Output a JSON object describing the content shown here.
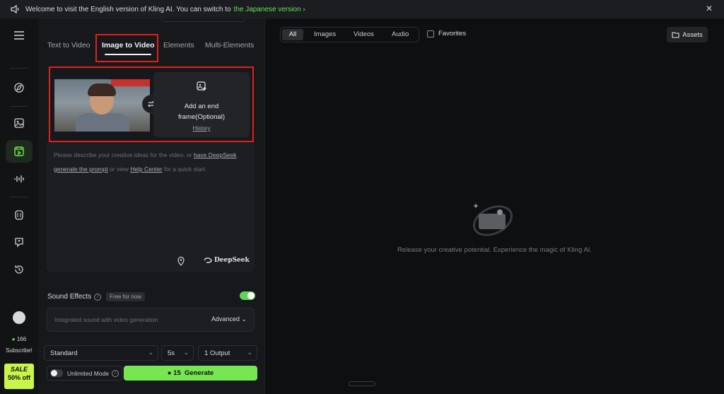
{
  "banner": {
    "message": "Welcome to visit the English version of Kling AI. You can switch to",
    "link": "the Japanese version ›",
    "close": "✕"
  },
  "sidebar": {
    "credits": "166",
    "subscribe": "Subscribe!",
    "sale_label": "SALE",
    "sale_discount": "50% off"
  },
  "tabs": [
    {
      "label": "Text to Video",
      "active": false
    },
    {
      "label": "Image to Video",
      "active": true
    },
    {
      "label": "Elements",
      "active": false
    },
    {
      "label": "Multi-Elements",
      "active": false
    }
  ],
  "frames": {
    "end_frame_label": "Add an end frame(Optional)",
    "history": "History"
  },
  "prompt": {
    "p1": "Please describe your creative ideas for the video, or ",
    "link1": "have DeepSeek generate the prompt",
    "p2": " or view ",
    "link2": "Help Center",
    "p3": " for a quick start.",
    "deepseek": "DeepSeek"
  },
  "sound": {
    "label": "Sound Effects",
    "badge": "Free for now",
    "placeholder": "Integrated sound with video generation",
    "advanced": "Advanced"
  },
  "controls": {
    "mode": "Standard",
    "duration": "5s",
    "outputs": "1 Output",
    "unlimited": "Unlimited Mode",
    "generate_cost": "15",
    "generate": "Generate"
  },
  "main": {
    "filters": [
      "All",
      "Images",
      "Videos",
      "Audio"
    ],
    "favorites": "Favorites",
    "assets": "Assets",
    "empty": "Release your creative potential. Experience the magic of Kling AI."
  },
  "colors": {
    "accent": "#76e653",
    "highlight": "#e0201b",
    "background": "#0e0f11"
  }
}
